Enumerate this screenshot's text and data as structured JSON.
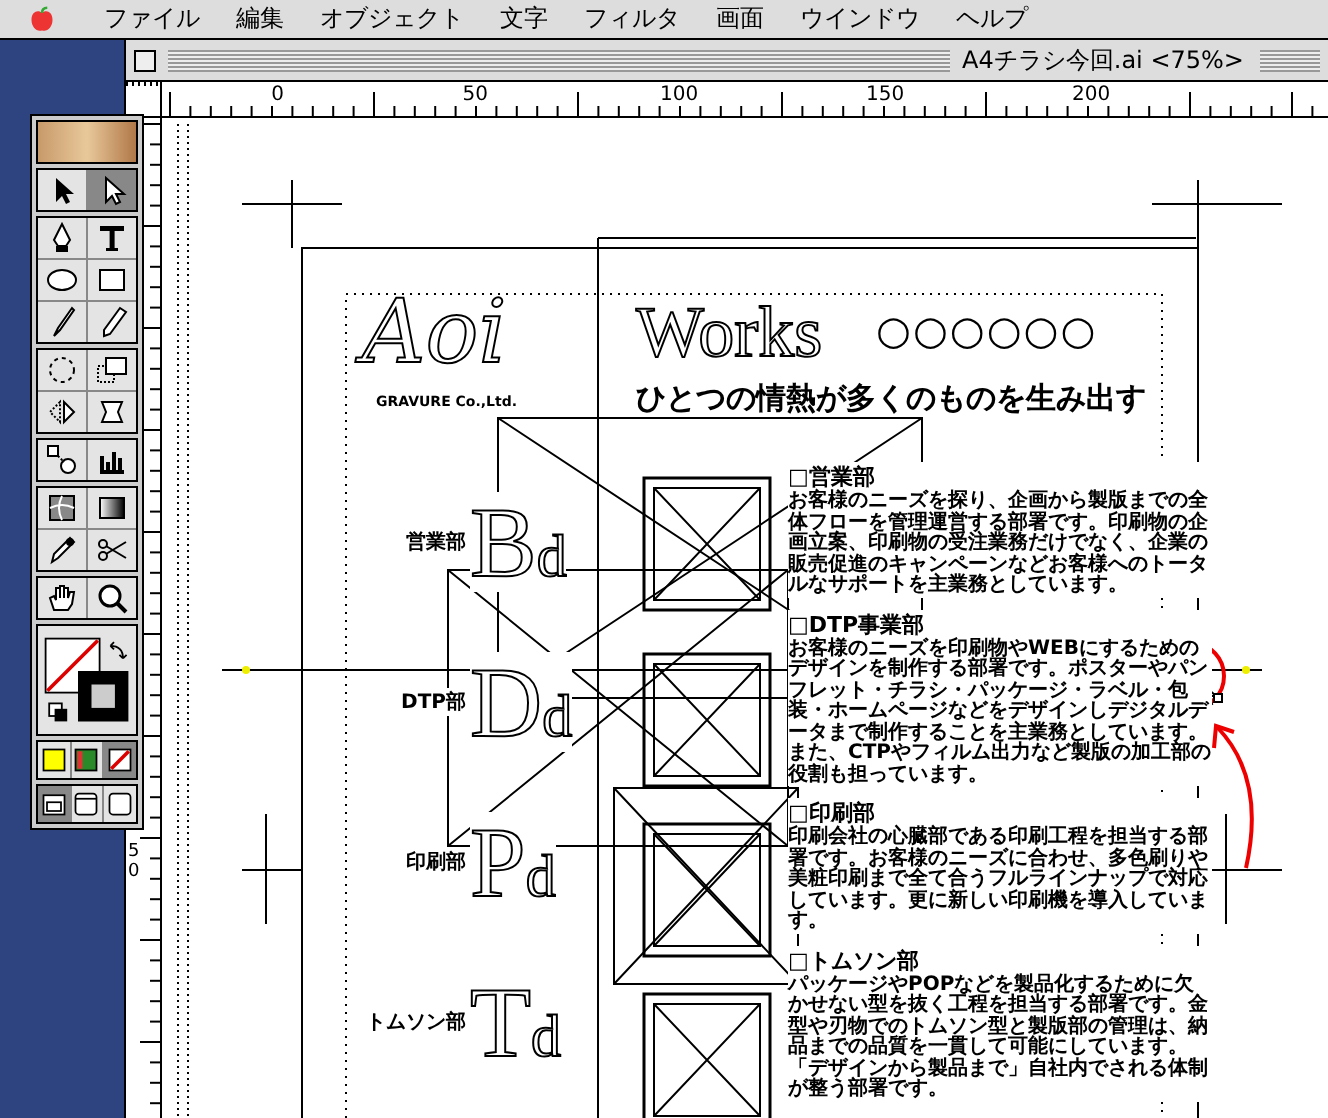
{
  "menu_bar": {
    "items": [
      "ファイル",
      "編集",
      "オブジェクト",
      "文字",
      "フィルタ",
      "画面",
      "ウインドウ",
      "ヘルプ"
    ]
  },
  "window": {
    "title": "A4チラシ今回.ai <75%>"
  },
  "rulers": {
    "horizontal_labels": [
      "0",
      "50",
      "100",
      "150",
      "200"
    ],
    "vertical_labels": [
      "50"
    ]
  },
  "toolbox": {
    "tools": [
      {
        "selected": false
      },
      {
        "selected": true
      },
      {
        "selected": false
      },
      {
        "selected": false
      },
      {
        "selected": false
      },
      {
        "selected": false
      },
      {
        "selected": false
      },
      {
        "selected": false
      },
      {
        "selected": false
      },
      {
        "selected": false
      },
      {
        "selected": false
      },
      {
        "selected": false
      },
      {
        "selected": false
      },
      {
        "selected": false
      },
      {
        "selected": false
      },
      {
        "selected": false
      },
      {
        "selected": false
      },
      {
        "selected": false
      },
      {
        "selected": false
      },
      {
        "selected": false
      }
    ],
    "color_modes": [
      {
        "selected": false
      },
      {
        "selected": false
      },
      {
        "selected": true
      }
    ],
    "screen_modes": [
      {
        "selected": true
      },
      {
        "selected": false
      },
      {
        "selected": false
      }
    ]
  },
  "artwork": {
    "logo": "Aoi",
    "company": "GRAVURE Co.,Ltd.",
    "headline": "Works",
    "circles": "○○○○○○",
    "tagline": "ひとつの情熱が多くのものを生み出す",
    "departments": [
      {
        "letters": "Bd",
        "label": "営業部"
      },
      {
        "letters": "Dd",
        "label": "DTP部"
      },
      {
        "letters": "Pd",
        "label": "印刷部"
      },
      {
        "letters": "Td",
        "label": "トムソン部"
      }
    ],
    "sections": [
      {
        "heading": "□営業部",
        "body": "お客様のニーズを探り、企画から製版までの全体フローを管理運営する部署です。印刷物の企画立案、印刷物の受注業務だけでなく、企業の販売促進のキャンペーンなどお客様へのトータルなサポートを主業務としています。"
      },
      {
        "heading": "□DTP事業部",
        "body": "お客様のニーズを印刷物やWEBにするためのデザインを制作する部署です。ポスターやパンフレット・チラシ・パッケージ・ラベル・包装・ホームページなどをデザインしデジタルデータまで制作することを主業務としています。また、CTPやフィルム出力など製版の加工部の役割も担っています。"
      },
      {
        "heading": "□印刷部",
        "body": "印刷会社の心臓部である印刷工程を担当する部署です。お客様のニーズに合わせ、多色刷りや美粧印刷まで全て合うフルラインナップで対応しています。更に新しい印刷機を導入しています。"
      },
      {
        "heading": "□トムソン部",
        "body": "パッケージやPOPなどを製品化するために欠かせない型を抜く工程を担当する部署です。金型や刃物でのトムソン型と製版部の管理は、納品までの品質を一貫して可能にしています。「デザインから製品まで」自社内でされる体制が整う部署です。"
      }
    ]
  }
}
